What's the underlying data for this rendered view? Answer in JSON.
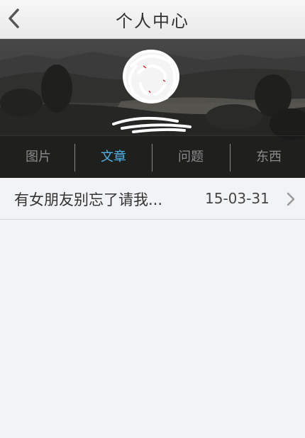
{
  "header": {
    "title": "个人中心",
    "back_icon": "chevron-left-icon"
  },
  "profile": {
    "avatar": "scribbled-avatar",
    "tabs": [
      {
        "label": "图片",
        "active": false
      },
      {
        "label": "文章",
        "active": true
      },
      {
        "label": "问题",
        "active": false
      },
      {
        "label": "东西",
        "active": false
      }
    ]
  },
  "articles": [
    {
      "title": "有女朋友别忘了请我...",
      "date": "15-03-31",
      "icon": "chevron-right-icon"
    }
  ],
  "colors": {
    "active_tab": "#4fb3e6",
    "inactive_tab": "#8b8b8b",
    "background": "#f2f3f5"
  }
}
